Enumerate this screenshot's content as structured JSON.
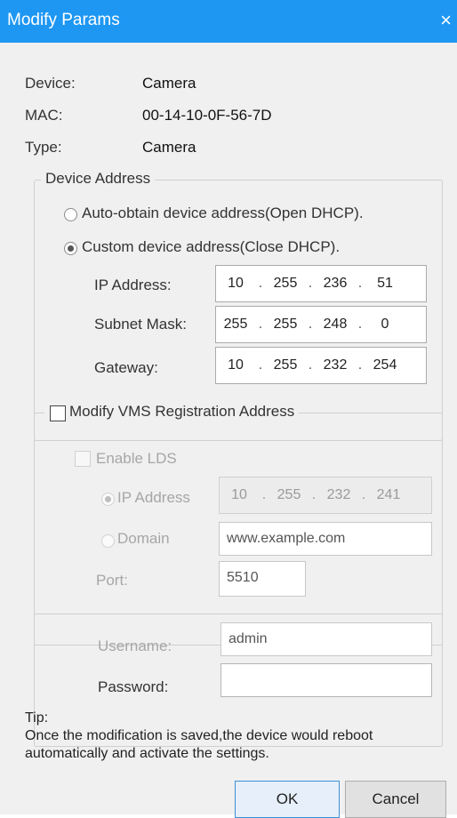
{
  "window": {
    "title": "Modify Params",
    "close_glyph": "×"
  },
  "info": {
    "device_label": "Device:",
    "device_value": "Camera",
    "mac_label": "MAC:",
    "mac_value": "00-14-10-0F-56-7D",
    "type_label": "Type:",
    "type_value": "Camera"
  },
  "device_address": {
    "legend": "Device Address",
    "auto_label": "Auto-obtain device address(Open DHCP).",
    "custom_label": "Custom device address(Close DHCP).",
    "selected": "custom",
    "ip_label": "IP Address:",
    "ip": [
      "10",
      "255",
      "236",
      "51"
    ],
    "mask_label": "Subnet Mask:",
    "mask": [
      "255",
      "255",
      "248",
      "0"
    ],
    "gateway_label": "Gateway:",
    "gateway": [
      "10",
      "255",
      "232",
      "254"
    ]
  },
  "vms": {
    "legend": "Modify VMS Registration Address",
    "checked": false,
    "enable_lds_label": "Enable LDS",
    "ip_option_label": "IP Address",
    "ip": [
      "10",
      "255",
      "232",
      "241"
    ],
    "domain_label": "Domain",
    "domain_value": "www.example.com",
    "port_label": "Port:",
    "port_value": "5510"
  },
  "credentials": {
    "username_label": "Username:",
    "username_value": "admin",
    "password_label": "Password:",
    "password_value": ""
  },
  "tip": {
    "heading": "Tip:",
    "line1": "Once the modification is saved,the device would reboot",
    "line2": "automatically and activate the settings."
  },
  "buttons": {
    "ok": "OK",
    "cancel": "Cancel"
  },
  "colors": {
    "titlebar": "#1e97f3",
    "dialog_bg": "#f0f0f0"
  }
}
